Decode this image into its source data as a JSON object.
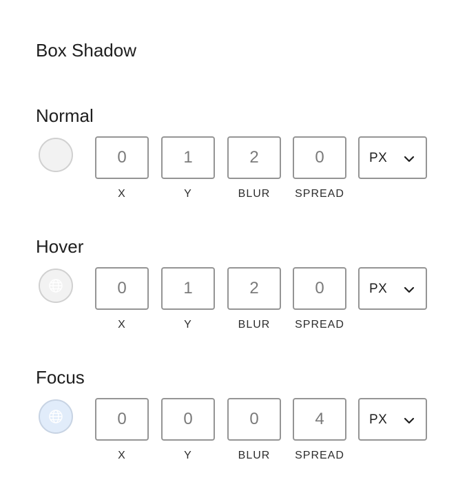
{
  "panel": {
    "title": "Box Shadow"
  },
  "labels": {
    "x": "X",
    "y": "Y",
    "blur": "BLUR",
    "spread": "SPREAD"
  },
  "colors": {
    "swatch_default": "#f2f2f2",
    "swatch_focus": "#e1ecfa",
    "border": "#949494"
  },
  "states": [
    {
      "title": "Normal",
      "swatch_icon": "",
      "x": "0",
      "y": "1",
      "blur": "2",
      "spread": "0",
      "unit": "PX"
    },
    {
      "title": "Hover",
      "swatch_icon": "globe-icon",
      "x": "0",
      "y": "1",
      "blur": "2",
      "spread": "0",
      "unit": "PX"
    },
    {
      "title": "Focus",
      "swatch_icon": "globe-icon",
      "x": "0",
      "y": "0",
      "blur": "0",
      "spread": "4",
      "unit": "PX"
    }
  ]
}
